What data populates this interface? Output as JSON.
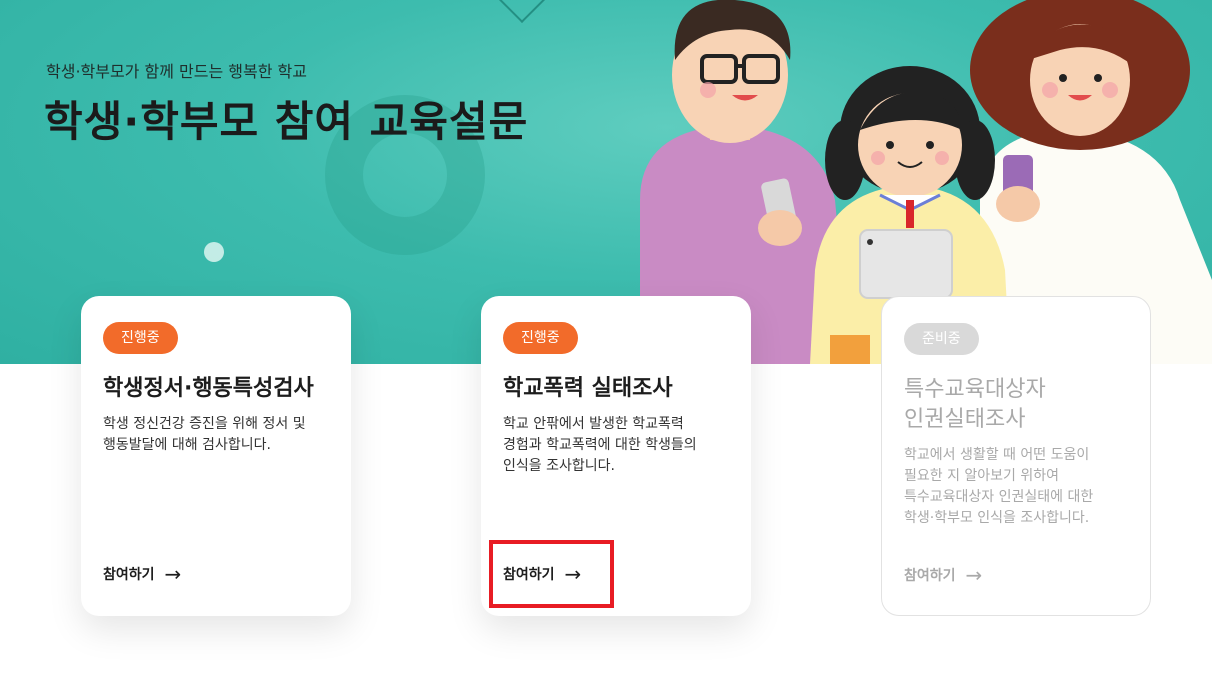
{
  "hero": {
    "subtitle": "학생·학부모가 함께 만드는 행복한 학교",
    "title": "학생·학부모 참여 교육설문"
  },
  "colors": {
    "hero_bg": "#3dbcae",
    "badge_active": "#f26b2a",
    "badge_inactive": "#d9d9d9",
    "highlight": "#e81c24"
  },
  "cards": [
    {
      "status": "진행중",
      "title": "학생정서·행동특성검사",
      "description": "학생 정신건강 증진을 위해 정서 및\n행동발달에 대해 검사합니다.",
      "action": "참여하기",
      "arrow": "→"
    },
    {
      "status": "진행중",
      "title": "학교폭력 실태조사",
      "description": "학교 안팎에서 발생한 학교폭력\n경험과 학교폭력에 대한 학생들의\n인식을 조사합니다.",
      "action": "참여하기",
      "arrow": "→"
    },
    {
      "status": "준비중",
      "title": "특수교육대상자\n인권실태조사",
      "description": "학교에서 생활할 때 어떤 도움이\n필요한 지 알아보기 위하여\n특수교육대상자 인권실태에 대한\n학생·학부모 인식을 조사합니다.",
      "action": "참여하기",
      "arrow": "→"
    }
  ]
}
